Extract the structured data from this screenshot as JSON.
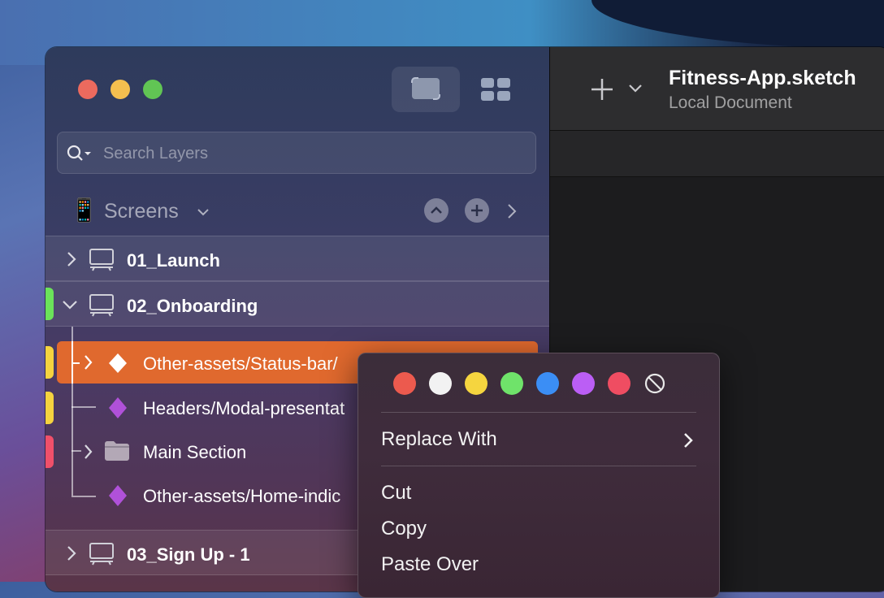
{
  "document": {
    "title": "Fitness-App.sketch",
    "subtitle": "Local Document"
  },
  "sidebar": {
    "search_placeholder": "Search Layers",
    "page_name": "Screens",
    "page_icon": "📱",
    "artboards": [
      {
        "label": "01_Launch",
        "expanded": false
      },
      {
        "label": "02_Onboarding",
        "expanded": true,
        "tag_color": "#6be35a"
      },
      {
        "label": "03_Sign Up - 1",
        "expanded": false
      }
    ],
    "layers": [
      {
        "label": "Other-assets/Status-bar/",
        "icon": "symbol-instance-icon",
        "selected": true,
        "tag_color": "#f5d33f"
      },
      {
        "label": "Headers/Modal-presentat",
        "icon": "symbol-icon",
        "tag_color": "#f5d33f"
      },
      {
        "label": "Main Section",
        "icon": "folder-icon",
        "tag_color": "#f0506a"
      },
      {
        "label": "Other-assets/Home-indic",
        "icon": "symbol-icon"
      }
    ]
  },
  "context_menu": {
    "colors": [
      "#ec5a4e",
      "#f2f2f2",
      "#f5d53f",
      "#6fe36a",
      "#3b8ef5",
      "#bb5ef5",
      "#ef4d62"
    ],
    "items": {
      "replace_with": "Replace With",
      "cut": "Cut",
      "copy": "Copy",
      "paste_over": "Paste Over"
    }
  }
}
